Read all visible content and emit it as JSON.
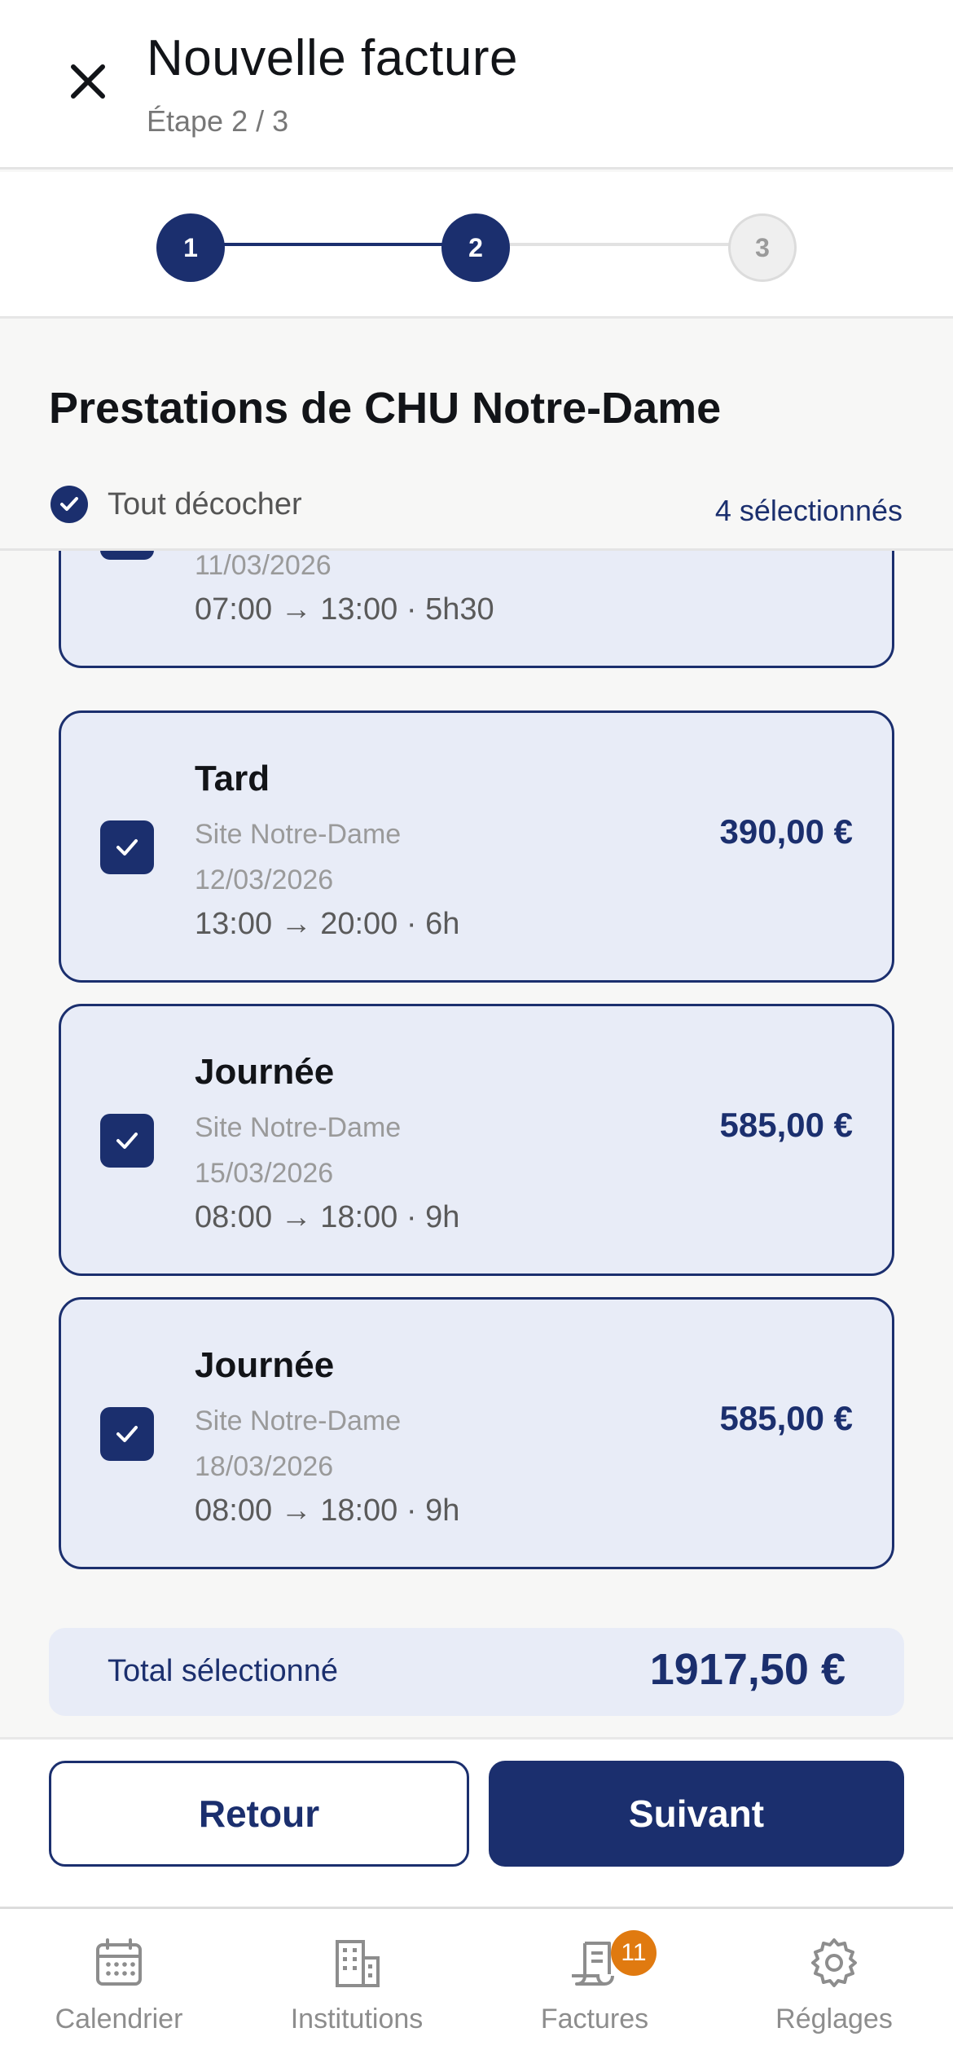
{
  "header": {
    "title": "Nouvelle facture",
    "subtitle": "Étape 2 / 3"
  },
  "stepper": {
    "steps": [
      "1",
      "2",
      "3"
    ],
    "current": 2
  },
  "section": {
    "title": "Prestations de CHU Notre-Dame",
    "toggle_all_label": "Tout décocher",
    "selected_count": "4 sélectionnés"
  },
  "prestations": [
    {
      "date": "11/03/2026",
      "time": "07:00 → 13:00 · 5h30",
      "checked": true
    },
    {
      "title": "Tard",
      "site": "Site Notre-Dame",
      "date": "12/03/2026",
      "time": "13:00 → 20:00 · 6h",
      "price": "390,00 €",
      "checked": true
    },
    {
      "title": "Journée",
      "site": "Site Notre-Dame",
      "date": "15/03/2026",
      "time": "08:00 → 18:00 · 9h",
      "price": "585,00 €",
      "checked": true
    },
    {
      "title": "Journée",
      "site": "Site Notre-Dame",
      "date": "18/03/2026",
      "time": "08:00 → 18:00 · 9h",
      "price": "585,00 €",
      "checked": true
    }
  ],
  "total": {
    "label": "Total sélectionné",
    "value": "1917,50 €"
  },
  "actions": {
    "back_label": "Retour",
    "next_label": "Suivant"
  },
  "nav": {
    "items": [
      {
        "label": "Calendrier",
        "icon": "calendar-icon"
      },
      {
        "label": "Institutions",
        "icon": "building-icon"
      },
      {
        "label": "Factures",
        "icon": "invoice-icon",
        "badge": "11"
      },
      {
        "label": "Réglages",
        "icon": "gear-icon"
      }
    ]
  },
  "colors": {
    "primary": "#1b2f6e",
    "card_bg": "#e8ecf7",
    "badge": "#e07a10"
  }
}
